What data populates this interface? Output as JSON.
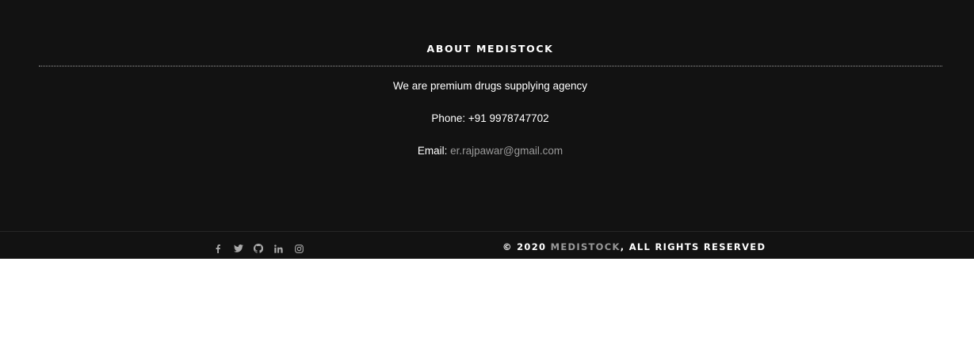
{
  "about": {
    "title": "ABOUT MEDISTOCK",
    "tagline": "We are premium drugs supplying agency",
    "phone": "Phone: +91 9978747702",
    "email_label": "Email: ",
    "email": "er.rajpawar@gmail.com"
  },
  "social": {
    "icons": [
      "facebook-icon",
      "twitter-icon",
      "github-icon",
      "linkedin-icon",
      "instagram-icon"
    ],
    "icon_color": "#aaaaaa"
  },
  "copyright": {
    "prefix": "© 2020 ",
    "brand": "MEDISTOCK",
    "suffix": ", ALL RIGHTS RESERVED"
  },
  "colors": {
    "footer_bg": "#121212",
    "text": "#ffffff",
    "muted": "#9a9a9a",
    "page_bg": "#ffffff"
  }
}
